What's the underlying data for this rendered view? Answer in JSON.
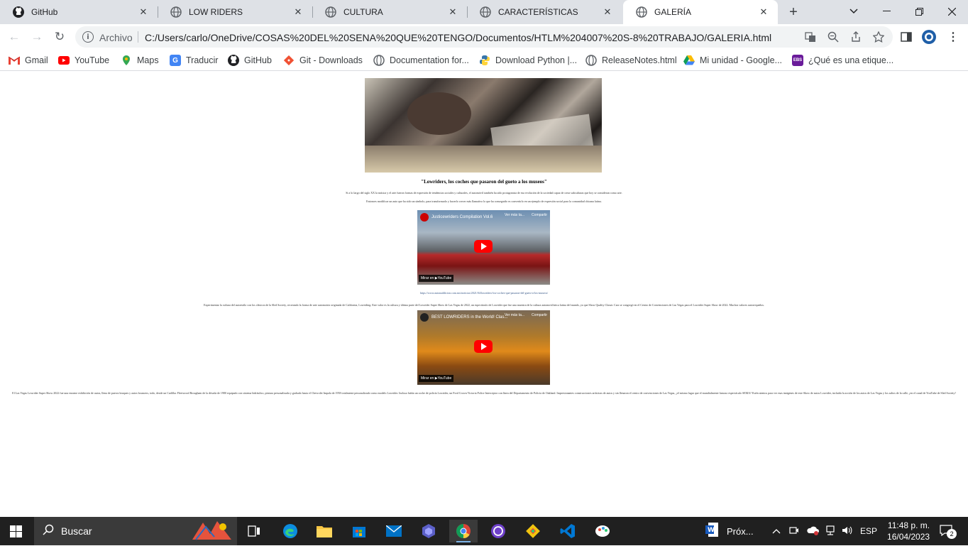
{
  "tabs": [
    {
      "title": "GitHub",
      "icon": "github-icon"
    },
    {
      "title": "LOW RIDERS",
      "icon": "globe-icon"
    },
    {
      "title": "CULTURA",
      "icon": "globe-icon"
    },
    {
      "title": "CARACTERÍSTICAS",
      "icon": "globe-icon"
    },
    {
      "title": "GALERÍA",
      "icon": "globe-icon",
      "active": true
    }
  ],
  "address": {
    "protocol_label": "Archivo",
    "url": "C:/Users/carlo/OneDrive/COSAS%20DEL%20SENA%20QUE%20TENGO/Documentos/HTLM%204007%20S-8%20TRABAJO/GALERIA.html"
  },
  "bookmarks": [
    {
      "label": "Gmail"
    },
    {
      "label": "YouTube"
    },
    {
      "label": "Maps"
    },
    {
      "label": "Traducir"
    },
    {
      "label": "GitHub"
    },
    {
      "label": "Git - Downloads"
    },
    {
      "label": "Documentation for..."
    },
    {
      "label": "Download Python |..."
    },
    {
      "label": "ReleaseNotes.html"
    },
    {
      "label": "Mi unidad - Google..."
    },
    {
      "label": "¿Qué es una etique..."
    }
  ],
  "page": {
    "title": "\"Lowriders, los coches que pasaron del gueto a los museos\"",
    "paragraph1": "Si a lo largo del siglo XX la música y el arte fueron formas de expresión de tendencias sociales y culturales, el automóvil también ha sido protagonista de esa evolución de la sociedad capaz de crear subculturas que hoy se consideran como arte.",
    "paragraph2": "Entonces modificar un auto que ha sido un símbolo, para transformarlo y hacerlo crecer más llamativo lo que ha conseguido es convertirlo en un ejemplo de expresión social para la comunidad chicana latina.",
    "video1": {
      "title": "Justicewriders Compilation Vol.6",
      "later": "Ver más ta...",
      "share": "Compartir",
      "watch": "Mirar en ▶YouTube"
    },
    "link1": "https://www.autonaddicion.com.mx/noticias/2021/04/lowriders-los-coches-que-pasaron-del-gueto-a-los-museos/",
    "paragraph3": "Experimentar la cultura del autoestilo con los clásicos de la Sled Society, recreando la forma de arte automotriz originada de California, Lowriding. Este valor es la cultura y última parte del Lowrider Super Show de Las Vegas de 2022, un espectáculo de Lowrider que fue una muestra de la cultura automovilística latina del mundo, ya que Show Quality Classic Cars se congregó en el Centro de Convenciones de Las Vegas para el Lowrider Super Show de 2022. Muchos valores autorriqueños.",
    "video2": {
      "title": "BEST LOWRIDERS in the World! Clas...",
      "later": "Ver más ta...",
      "share": "Compartir",
      "watch": "Mirar en ▶YouTube"
    },
    "paragraph4": "El Las Vegas Lowrider Super Show 2022 fue una enorme exhibición de autos, llena de pueros bruques y autos bouncers, todo, desde un Cadillac Fleetwood Brougham de la década de 1980 equipado con sistema hidráulico, pintura personalizada y grabado hasta el Chevrolet Impala de 1958 totalmente personalizado como modelo Lowrider. Incluso había un coche de policía Lowrider, un Ford Crown Victoria Police Interceptor con línea del Departamento de Policía de Oakland. Impresionantes construcciones artísticas de autos y sin llenaron el centro de convenciones de Las Vegas, ¿el mismo lugar que el mundialmente famoso espectáculo SEMA? Estén atentos para ver esas imágenes de este Show de autos Lowrider, incluida la acción de los autos de Las Vegas y los saltos de la calle, ¡en el canal de YouTube de Sled Society!"
  },
  "taskbar": {
    "search_placeholder": "Buscar",
    "next_label": "Próx...",
    "lang": "ESP",
    "time": "11:48 p. m.",
    "date": "16/04/2023",
    "notifications": "2"
  },
  "colors": {
    "tabstrip": "#dee1e6",
    "taskbar": "#202020",
    "youtube_red": "#ff0000"
  }
}
